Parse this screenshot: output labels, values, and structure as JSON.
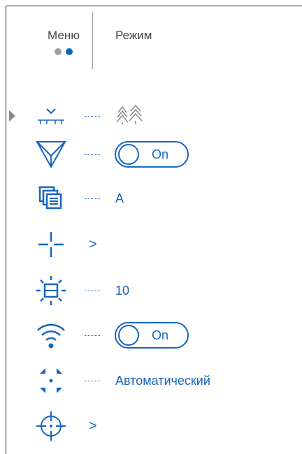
{
  "header": {
    "tabs": [
      {
        "label": "Меню"
      },
      {
        "label": "Режим"
      }
    ]
  },
  "colors": {
    "accent": "#1565c0",
    "inactive_dot": "#9e9e9e",
    "pointer": "#888888"
  },
  "items": [
    {
      "icon": "range-finder-icon",
      "value_icon": "forest-trees-icon",
      "type": "icon-value",
      "selected": true
    },
    {
      "icon": "funnel-filter-icon",
      "type": "toggle",
      "toggle_label": "On"
    },
    {
      "icon": "image-gallery-icon",
      "type": "value",
      "value": "A"
    },
    {
      "icon": "reticle-crosshair-icon",
      "type": "submenu",
      "chevron": ">"
    },
    {
      "icon": "display-brightness-icon",
      "type": "value",
      "value": "10"
    },
    {
      "icon": "wifi-icon",
      "type": "toggle",
      "toggle_label": "On"
    },
    {
      "icon": "auto-shutdown-icon",
      "type": "value",
      "value": "Автоматический"
    },
    {
      "icon": "zeroing-crosshair-icon",
      "type": "submenu",
      "chevron": ">"
    }
  ]
}
